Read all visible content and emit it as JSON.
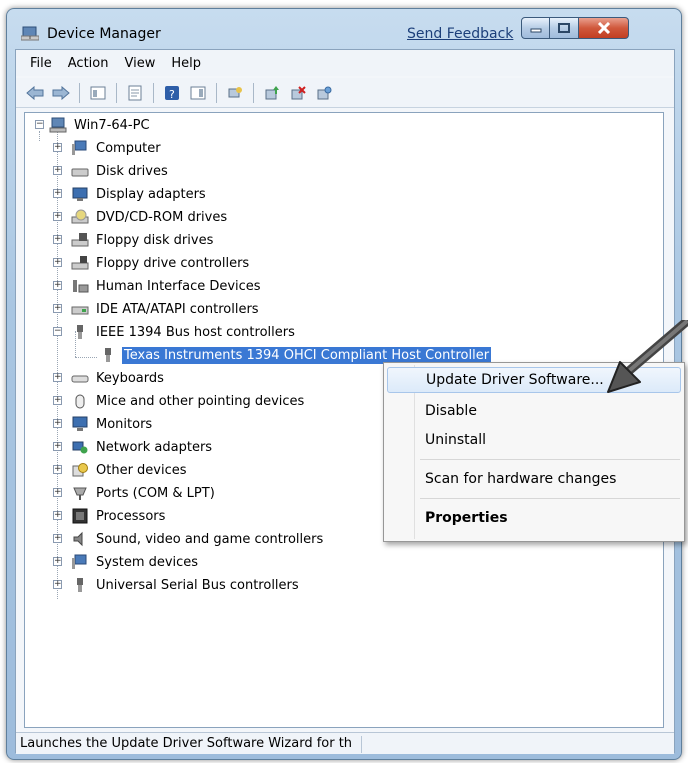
{
  "window": {
    "title": "Device Manager",
    "feedback_link": "Send Feedback",
    "accent_color": "#3a78d4"
  },
  "menubar": [
    "File",
    "Action",
    "View",
    "Help"
  ],
  "toolbar": {
    "icons": [
      "back-arrow-icon",
      "forward-arrow-icon",
      "show-hide-tree-icon",
      "properties-icon",
      "help-icon",
      "action-pane-icon",
      "scan-hardware-icon",
      "update-driver-icon",
      "uninstall-device-icon",
      "disable-device-icon"
    ]
  },
  "tree": {
    "root": "Win7-64-PC",
    "categories": [
      "Computer",
      "Disk drives",
      "Display adapters",
      "DVD/CD-ROM drives",
      "Floppy disk drives",
      "Floppy drive controllers",
      "Human Interface Devices",
      "IDE ATA/ATAPI controllers",
      "IEEE 1394 Bus host controllers",
      "Keyboards",
      "Mice and other pointing devices",
      "Monitors",
      "Network adapters",
      "Other devices",
      "Ports (COM & LPT)",
      "Processors",
      "Sound, video and game controllers",
      "System devices",
      "Universal Serial Bus controllers"
    ],
    "expanded_child": "Texas Instruments 1394 OHCI Compliant Host Controller"
  },
  "context_menu": {
    "items": [
      "Update Driver Software...",
      "Disable",
      "Uninstall",
      "Scan for hardware changes",
      "Properties"
    ]
  },
  "status": {
    "text": "Launches the Update Driver Software Wizard for th"
  }
}
